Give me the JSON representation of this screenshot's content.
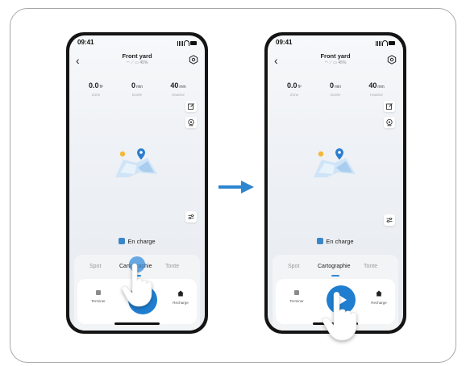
{
  "screens": [
    {
      "status": {
        "time": "09:41"
      },
      "header": {
        "title": "Front yard",
        "battery": "45%"
      },
      "stats": [
        {
          "value": "0.0",
          "unit": "ft²",
          "label": "Zone"
        },
        {
          "value": "0",
          "unit": "min",
          "label": "Durée"
        },
        {
          "value": "40",
          "unit": "mm",
          "label": "Hauteur"
        }
      ],
      "charge_status": "En charge",
      "tabs": [
        "Spot",
        "Cartographie",
        "Tonte"
      ],
      "active_tab": "Cartographie",
      "actions": {
        "left": "Terminer",
        "right": "Recharge"
      }
    },
    {
      "status": {
        "time": "09:41"
      },
      "header": {
        "title": "Front yard",
        "battery": "45%"
      },
      "stats": [
        {
          "value": "0.0",
          "unit": "ft²",
          "label": "Zone"
        },
        {
          "value": "0",
          "unit": "min",
          "label": "Durée"
        },
        {
          "value": "40",
          "unit": "mm",
          "label": "Hauteur"
        }
      ],
      "charge_status": "En charge",
      "tabs": [
        "Spot",
        "Cartographie",
        "Tonte"
      ],
      "active_tab": "Cartographie",
      "actions": {
        "left": "Terminer",
        "right": "Recharge"
      }
    }
  ],
  "colors": {
    "accent": "#1f7ed0",
    "arrow": "#2d86cf",
    "background": "#eef1f5"
  },
  "icons": [
    "back-chevron-icon",
    "settings-hex-icon",
    "edit-icon",
    "location-icon",
    "adjust-icon",
    "stop-icon",
    "play-icon",
    "home-icon",
    "robot-charge-icon",
    "map-illustration-icon",
    "hand-pointer-icon"
  ]
}
